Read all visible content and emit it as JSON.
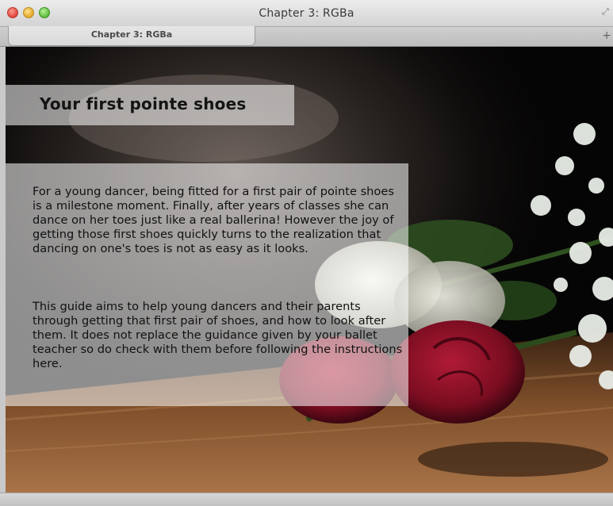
{
  "window": {
    "title": "Chapter 3: RGBa",
    "controls": [
      "close",
      "minimize",
      "zoom"
    ]
  },
  "tabs": [
    {
      "label": "Chapter 3: RGBa",
      "active": true
    }
  ],
  "icons": {
    "fullscreen": "fullscreen-icon",
    "new_tab": "plus-icon"
  },
  "article": {
    "heading": "Your first pointe shoes",
    "paragraphs": [
      "For a young dancer, being fitted for a first pair of pointe shoes is a milestone moment. Finally, after years of classes she can dance on her toes just like a real ballerina! However the joy of getting those first shoes quickly turns to the realization that dancing on one's toes is not as easy as it looks.",
      "This guide aims to help young dancers and their parents through getting that first pair of shoes, and how to look after them. It does not replace the guidance given by your ballet teacher so do check with them before following the instructions here."
    ]
  },
  "colors": {
    "panel_overlay": "rgba(255,255,255,0.55)",
    "rose": "#8a0f24",
    "wood": "#7a4a26"
  }
}
